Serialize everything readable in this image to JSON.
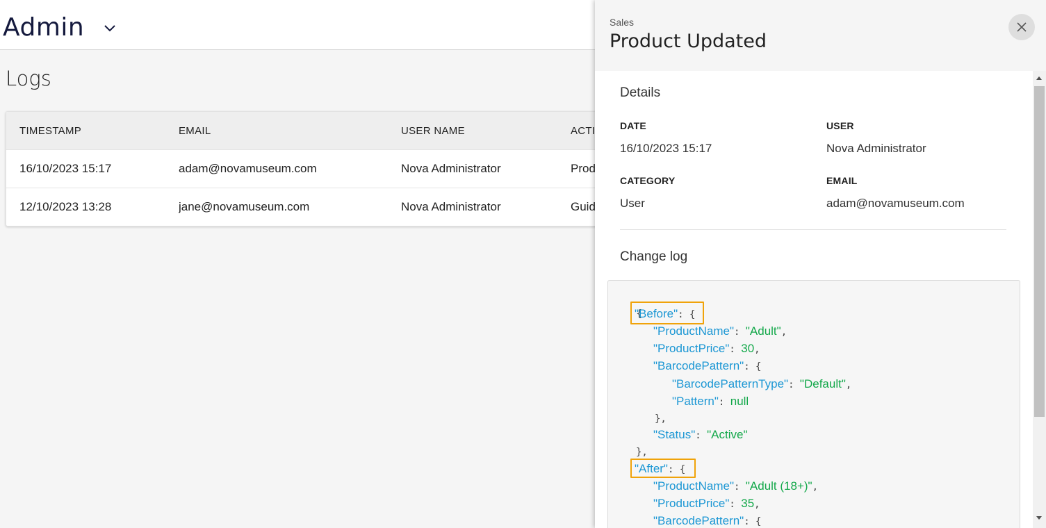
{
  "header": {
    "app_name": "Admin",
    "menu_icon": "chevron-down-icon"
  },
  "page": {
    "title": "Logs"
  },
  "table": {
    "columns": [
      "TIMESTAMP",
      "EMAIL",
      "USER NAME",
      "ACTI"
    ],
    "rows": [
      {
        "timestamp": "16/10/2023 15:17",
        "email": "adam@novamuseum.com",
        "user_name": "Nova Administrator",
        "action": "Prod"
      },
      {
        "timestamp": "12/10/2023 13:28",
        "email": "jane@novamuseum.com",
        "user_name": "Nova Administrator",
        "action": "Guid"
      }
    ]
  },
  "panel": {
    "category": "Sales",
    "title": "Product Updated",
    "close_icon": "close-icon",
    "details_title": "Details",
    "fields": {
      "date_label": "DATE",
      "date_value": "16/10/2023 15:17",
      "user_label": "USER",
      "user_value": "Nova Administrator",
      "category_label": "CATEGORY",
      "category_value": "User",
      "email_label": "EMAIL",
      "email_value": "adam@novamuseum.com"
    },
    "change_log_title": "Change log",
    "change_log": {
      "open_brace": "{",
      "before_key": "\"Before\"",
      "before": {
        "product_name_key": "\"ProductName\"",
        "product_name_value": "\"Adult\"",
        "product_price_key": "\"ProductPrice\"",
        "product_price_value": "30",
        "barcode_pattern_key": "\"BarcodePattern\"",
        "barcode_pattern_type_key": "\"BarcodePatternType\"",
        "barcode_pattern_type_value": "\"Default\"",
        "pattern_key": "\"Pattern\"",
        "pattern_value": "null",
        "status_key": "\"Status\"",
        "status_value": "\"Active\""
      },
      "after_key": "\"After\"",
      "after": {
        "product_name_key": "\"ProductName\"",
        "product_name_value": "\"Adult (18+)\"",
        "product_price_key": "\"ProductPrice\"",
        "product_price_value": "35",
        "barcode_pattern_key": "\"BarcodePattern\""
      }
    }
  },
  "colors": {
    "json_key": "#1c97d4",
    "json_value": "#13a84a",
    "highlight": "#f0a30a",
    "brand_title": "#14193d"
  }
}
